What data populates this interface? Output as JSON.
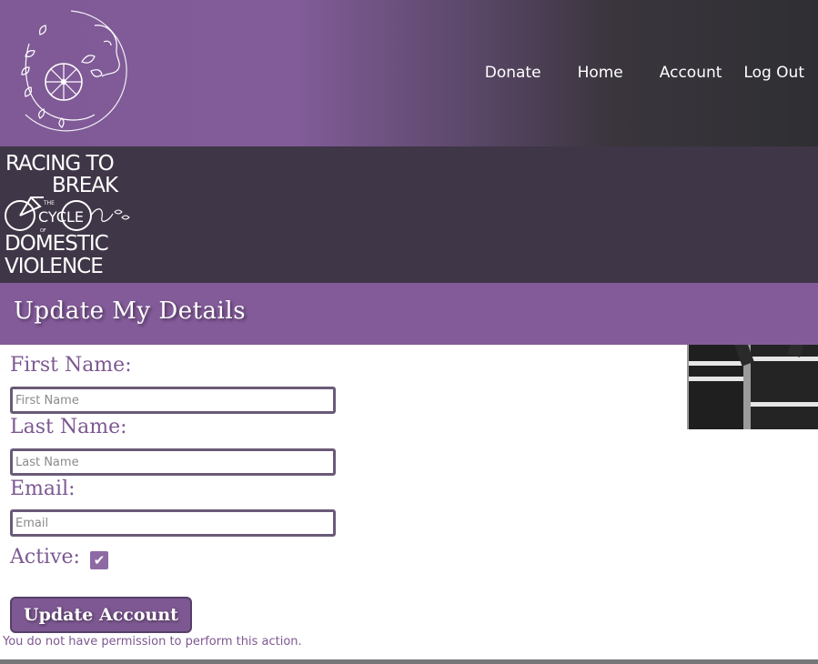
{
  "header": {
    "logo_icon": "cyclist-woman-floral-logo-icon",
    "nav": [
      {
        "label": "Donate"
      },
      {
        "label": "Home"
      },
      {
        "label": "Account"
      },
      {
        "label": "Log Out"
      }
    ]
  },
  "banner": {
    "brand_lines": [
      "RACING TO",
      "BREAK",
      "THE",
      "CYCLE",
      "OF",
      "DOMESTIC",
      "VIOLENCE"
    ],
    "photo_icon": "team-cyclists-photo"
  },
  "page": {
    "title": "Update My Details"
  },
  "form": {
    "first_name_label": "First Name:",
    "first_name_placeholder": "First Name",
    "first_name_value": "",
    "last_name_label": "Last Name:",
    "last_name_placeholder": "Last Name",
    "last_name_value": "",
    "email_label": "Email:",
    "email_placeholder": "Email",
    "email_value": "",
    "active_label": "Active:",
    "active_checked": true,
    "submit_label": "Update Account",
    "error_message": "You do not have permission to perform this action."
  },
  "colors": {
    "brand_purple": "#835b99",
    "banner_dark": "#3f3647",
    "header_dark": "#2f2f33",
    "label_purple": "#7d5892"
  }
}
